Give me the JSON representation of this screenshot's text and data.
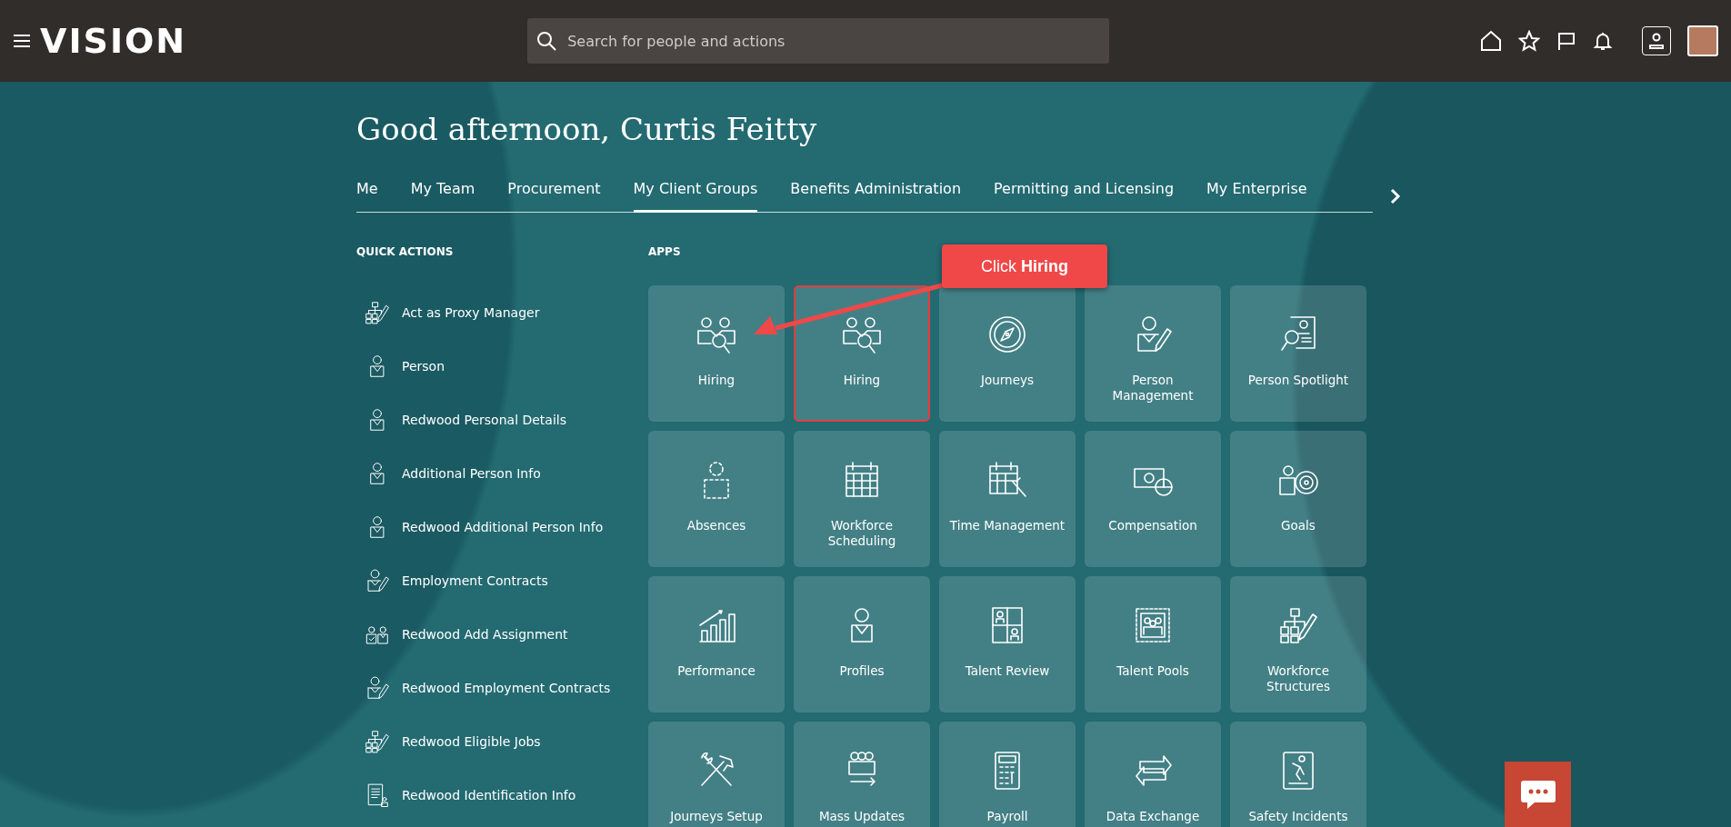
{
  "header": {
    "logo": "VISION",
    "search": {
      "placeholder": "Search for people and actions"
    }
  },
  "greeting": "Good afternoon, Curtis Feitty",
  "tabs": [
    {
      "label": "Me",
      "selected": false
    },
    {
      "label": "My Team",
      "selected": false
    },
    {
      "label": "Procurement",
      "selected": false
    },
    {
      "label": "My Client Groups",
      "selected": true
    },
    {
      "label": "Benefits Administration",
      "selected": false
    },
    {
      "label": "Permitting and Licensing",
      "selected": false
    },
    {
      "label": "My Enterprise",
      "selected": false
    }
  ],
  "quick_actions": {
    "title": "QUICK ACTIONS",
    "items": [
      {
        "label": "Act as Proxy Manager",
        "kind": "org"
      },
      {
        "label": "Person",
        "kind": "person"
      },
      {
        "label": "Redwood Personal Details",
        "kind": "person"
      },
      {
        "label": "Additional Person Info",
        "kind": "person"
      },
      {
        "label": "Redwood Additional Person Info",
        "kind": "person"
      },
      {
        "label": "Employment Contracts",
        "kind": "contract"
      },
      {
        "label": "Redwood Add Assignment",
        "kind": "assignment"
      },
      {
        "label": "Redwood Employment Contracts",
        "kind": "contract"
      },
      {
        "label": "Redwood Eligible Jobs",
        "kind": "org"
      },
      {
        "label": "Redwood Identification Info",
        "kind": "document"
      }
    ]
  },
  "apps": {
    "title": "APPS",
    "items": [
      {
        "label": "Hiring",
        "highlighted": false
      },
      {
        "label": "Hiring",
        "highlighted": true
      },
      {
        "label": "Journeys",
        "highlighted": false
      },
      {
        "label": "Person Management",
        "highlighted": false
      },
      {
        "label": "Person Spotlight",
        "highlighted": false
      },
      {
        "label": "Absences",
        "highlighted": false
      },
      {
        "label": "Workforce Scheduling",
        "highlighted": false
      },
      {
        "label": "Time Management",
        "highlighted": false
      },
      {
        "label": "Compensation",
        "highlighted": false
      },
      {
        "label": "Goals",
        "highlighted": false
      },
      {
        "label": "Performance",
        "highlighted": false
      },
      {
        "label": "Profiles",
        "highlighted": false
      },
      {
        "label": "Talent Review",
        "highlighted": false
      },
      {
        "label": "Talent Pools",
        "highlighted": false
      },
      {
        "label": "Workforce Structures",
        "highlighted": false
      },
      {
        "label": "Journeys Setup",
        "highlighted": false
      },
      {
        "label": "Mass Updates",
        "highlighted": false
      },
      {
        "label": "Payroll",
        "highlighted": false
      },
      {
        "label": "Data Exchange",
        "highlighted": false
      },
      {
        "label": "Safety Incidents",
        "highlighted": false
      }
    ]
  },
  "callout": "Click **Hiring**"
}
